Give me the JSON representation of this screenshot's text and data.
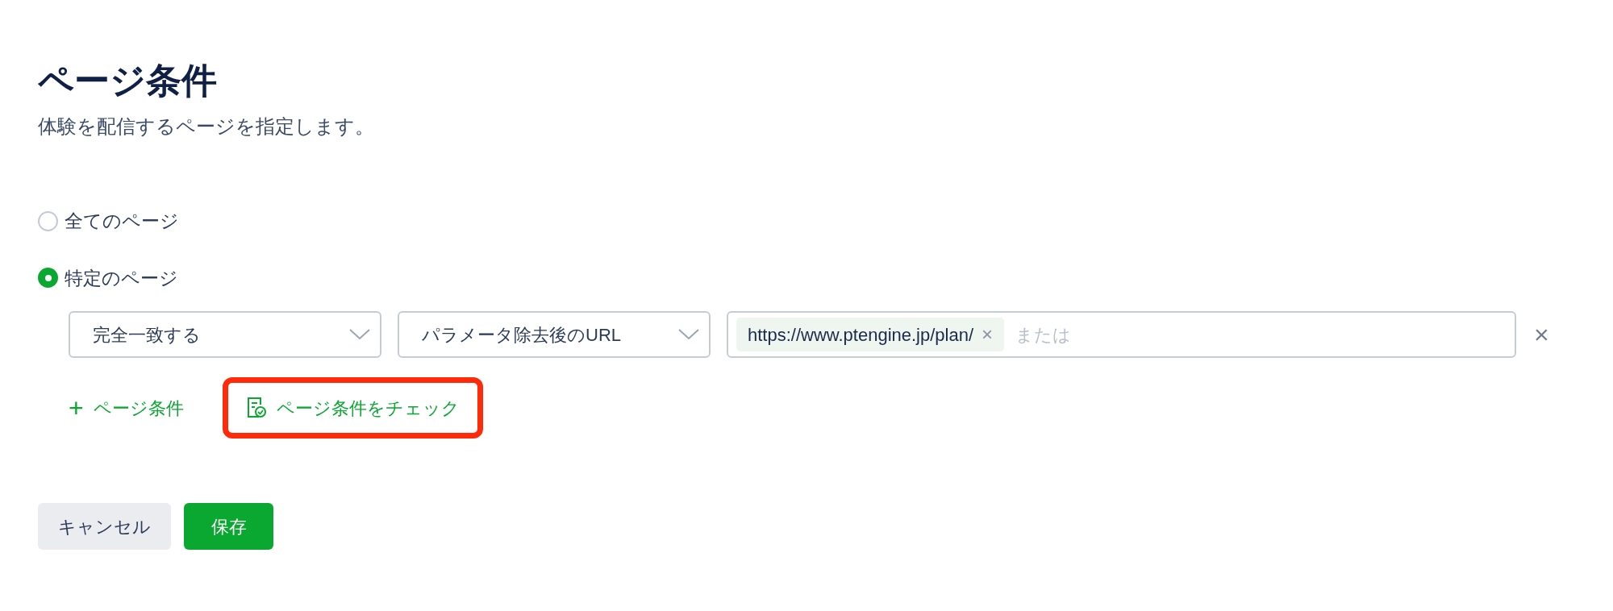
{
  "title": "ページ条件",
  "description": "体験を配信するページを指定します。",
  "scope_options": [
    {
      "label": "全てのページ",
      "selected": false
    },
    {
      "label": "特定のページ",
      "selected": true
    }
  ],
  "condition_row": {
    "match_select": {
      "value": "完全一致する"
    },
    "target_select": {
      "value": "パラメータ除去後のURL"
    },
    "url_input": {
      "tags": [
        "https://www.ptengine.jp/plan/"
      ],
      "placeholder": "または",
      "tag_remove": "×"
    },
    "remove": "×"
  },
  "actions": [
    {
      "kind": "add",
      "icon": "+",
      "label": "ページ条件",
      "highlighted": false
    },
    {
      "kind": "check",
      "label": "ページ条件をチェック",
      "highlighted": true
    }
  ],
  "buttons": [
    {
      "kind": "secondary",
      "label": "キャンセル"
    },
    {
      "kind": "primary",
      "label": "保存"
    }
  ]
}
